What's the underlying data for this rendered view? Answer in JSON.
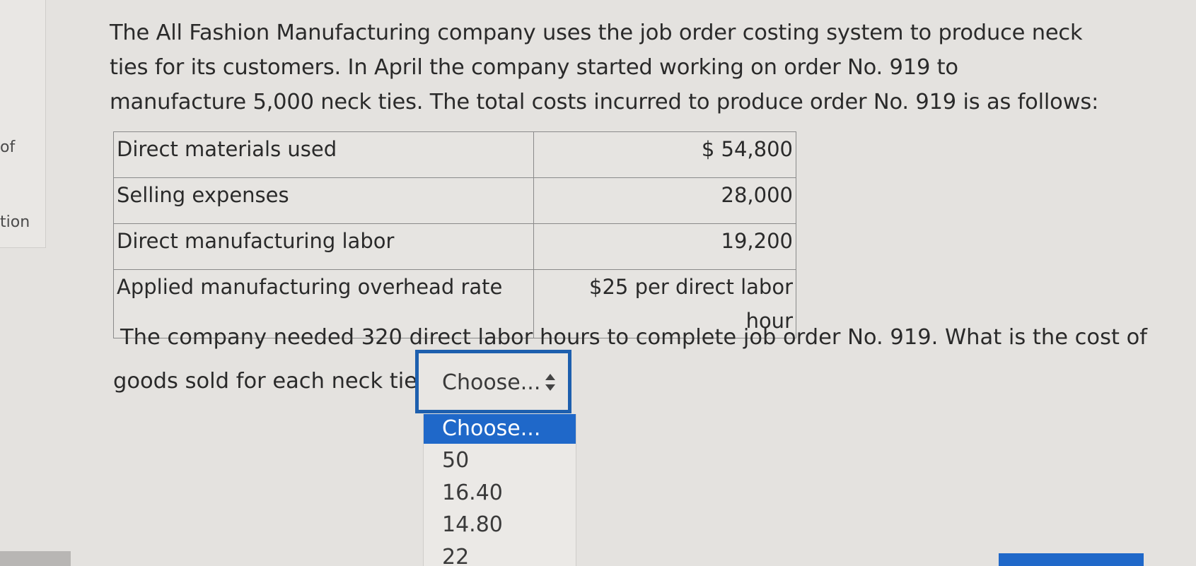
{
  "question": {
    "intro": "The All Fashion Manufacturing company uses the job order costing system to produce neck ties for its customers. In April the company started working on order No. 919 to manufacture 5,000 neck ties. The total costs incurred to produce order No. 919 is as follows:",
    "followup_line1": "The company needed 320 direct labor hours to complete job order No. 919. What is the cost of",
    "followup_line2": "goods sold for each neck tie?"
  },
  "left_fragments": [
    "of",
    "tion"
  ],
  "cost_table": {
    "rows": [
      {
        "label": "Direct materials used",
        "value": "$ 54,800"
      },
      {
        "label": "Selling expenses",
        "value": "28,000"
      },
      {
        "label": "Direct manufacturing labor",
        "value": "19,200"
      },
      {
        "label": "Applied manufacturing overhead rate",
        "value": "$25 per direct labor hour"
      }
    ]
  },
  "answer_select": {
    "selected": "Choose...",
    "options": [
      "Choose...",
      "50",
      "16.40",
      "14.80",
      "22"
    ]
  },
  "colors": {
    "accent": "#1f68c9",
    "select_border": "#1d5fae",
    "background": "#e4e2df"
  }
}
